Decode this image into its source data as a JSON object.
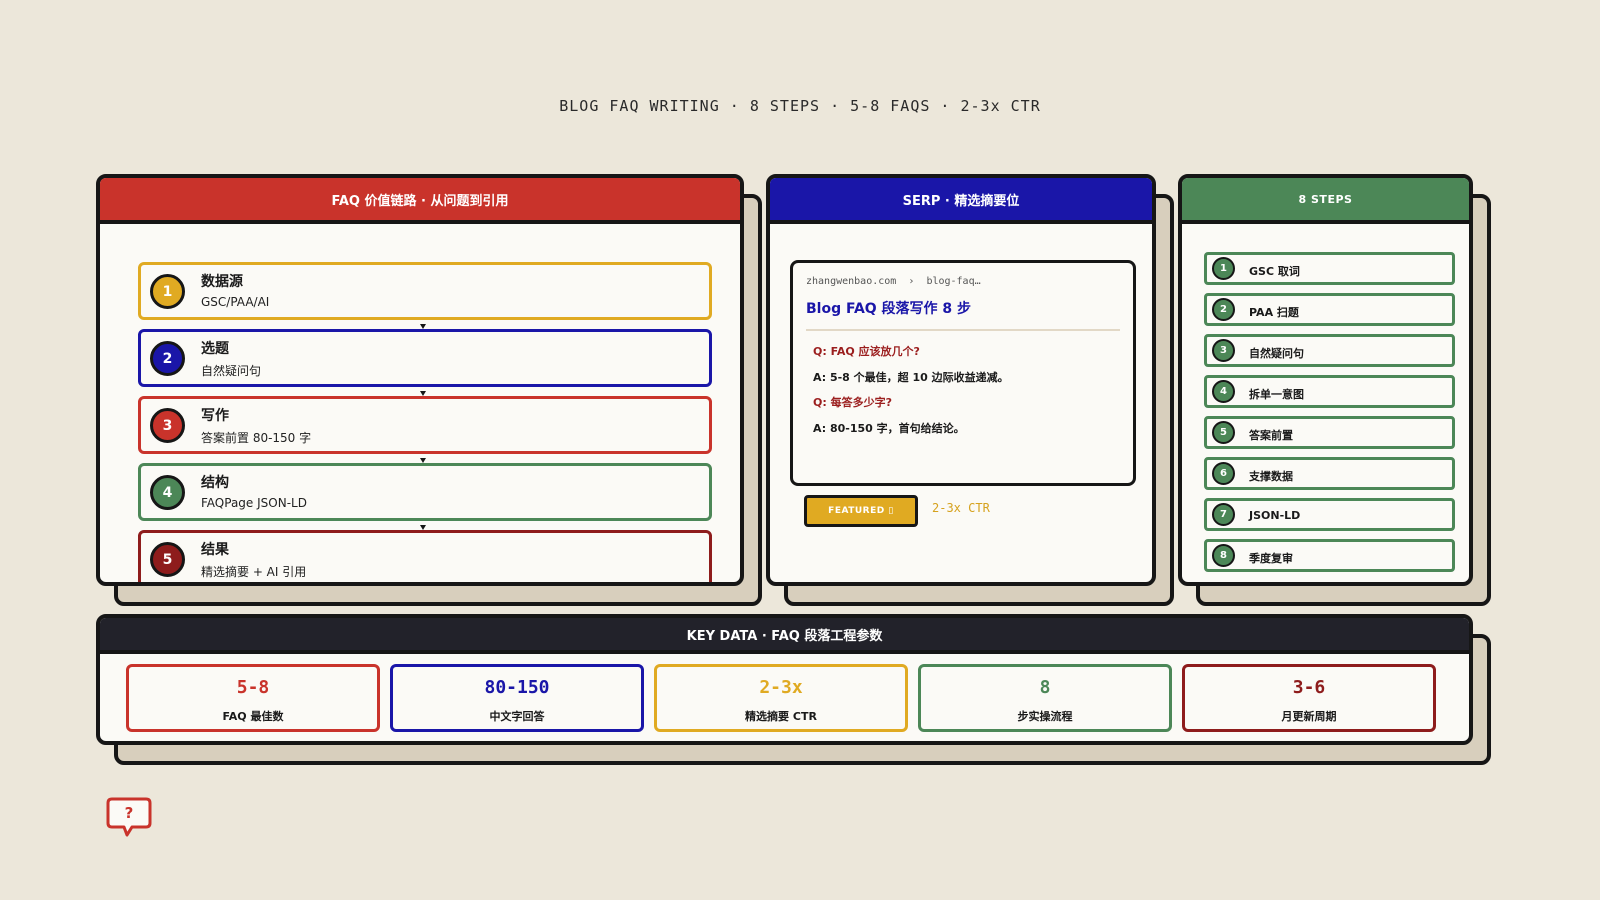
{
  "page_title": "BLOG FAQ WRITING · 8 STEPS · 5-8 FAQS · 2-3x CTR",
  "colors": {
    "background": "#ece7da",
    "red": "#c9332b",
    "navy": "#1a16a8",
    "green": "#4c8757",
    "gold": "#e0aa22",
    "dark_red": "#8e1c1c",
    "dark": "#22222a"
  },
  "chain_panel": {
    "header": "FAQ 价值链路 · 从问题到引用",
    "steps": [
      {
        "num": "1",
        "title": "数据源",
        "sub": "GSC/PAA/AI",
        "color": "#e0aa22"
      },
      {
        "num": "2",
        "title": "选题",
        "sub": "自然疑问句",
        "color": "#1a16a8"
      },
      {
        "num": "3",
        "title": "写作",
        "sub": "答案前置 80-150 字",
        "color": "#c9332b"
      },
      {
        "num": "4",
        "title": "结构",
        "sub": "FAQPage JSON-LD",
        "color": "#4c8757"
      },
      {
        "num": "5",
        "title": "结果",
        "sub": "精选摘要 + AI 引用",
        "color": "#8e1c1c"
      }
    ]
  },
  "serp_panel": {
    "header": "SERP · 精选摘要位",
    "url_domain": "zhangwenbao.com",
    "url_sep": "›",
    "url_path": "blog-faq…",
    "result_title": "Blog FAQ 段落写作 8 步",
    "qa": [
      {
        "q": "Q: FAQ 应该放几个?",
        "a": "A: 5-8 个最佳，超 10 边际收益递减。"
      },
      {
        "q": "Q: 每答多少字?",
        "a": "A: 80-150 字，首句给结论。"
      }
    ],
    "badge": "FEATURED ▯",
    "ctr": "2-3x  CTR"
  },
  "steps_panel": {
    "header": "8  STEPS",
    "items": [
      {
        "num": "1",
        "label": "GSC 取词"
      },
      {
        "num": "2",
        "label": "PAA 扫题"
      },
      {
        "num": "3",
        "label": "自然疑问句"
      },
      {
        "num": "4",
        "label": "拆单一意图"
      },
      {
        "num": "5",
        "label": "答案前置"
      },
      {
        "num": "6",
        "label": "支撑数据"
      },
      {
        "num": "7",
        "label": "JSON-LD"
      },
      {
        "num": "8",
        "label": "季度复审"
      }
    ]
  },
  "key_data_panel": {
    "header": "KEY DATA · FAQ 段落工程参数",
    "cards": [
      {
        "value": "5-8",
        "label": "FAQ 最佳数",
        "color": "#c9332b"
      },
      {
        "value": "80-150",
        "label": "中文字回答",
        "color": "#1a16a8"
      },
      {
        "value": "2-3x",
        "label": "精选摘要 CTR",
        "color": "#e0aa22"
      },
      {
        "value": "8",
        "label": "步实操流程",
        "color": "#4c8757"
      },
      {
        "value": "3-6",
        "label": "月更新周期",
        "color": "#8e1c1c"
      }
    ]
  },
  "corner_icon": {
    "name": "faq-bubble-icon",
    "glyph": "?"
  }
}
